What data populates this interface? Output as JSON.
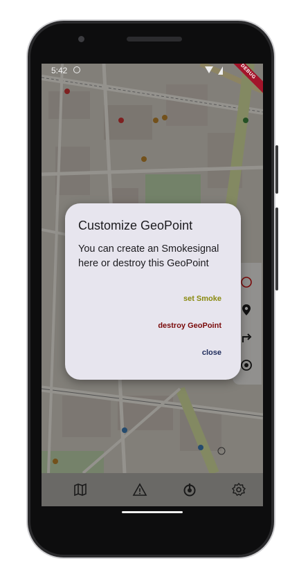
{
  "status_bar": {
    "time": "5:42",
    "debug_banner": "DEBUG"
  },
  "dialog": {
    "title": "Customize GeoPoint",
    "body": "You can create an Smokesignal here or destroy this GeoPoint",
    "buttons": {
      "set_smoke": "set Smoke",
      "destroy": "destroy GeoPoint",
      "close": "close"
    },
    "colors": {
      "set_smoke": "#8a8a0f",
      "destroy": "#7a0a0a",
      "close": "#1d2a5a",
      "background": "#e7e5ee"
    }
  },
  "side_controls": [
    "circle-outline-icon",
    "location-pin-icon",
    "turn-right-arrow-icon",
    "target-icon"
  ],
  "bottom_nav": {
    "items": [
      "map-icon",
      "warning-icon",
      "power-icon",
      "settings-icon"
    ]
  }
}
